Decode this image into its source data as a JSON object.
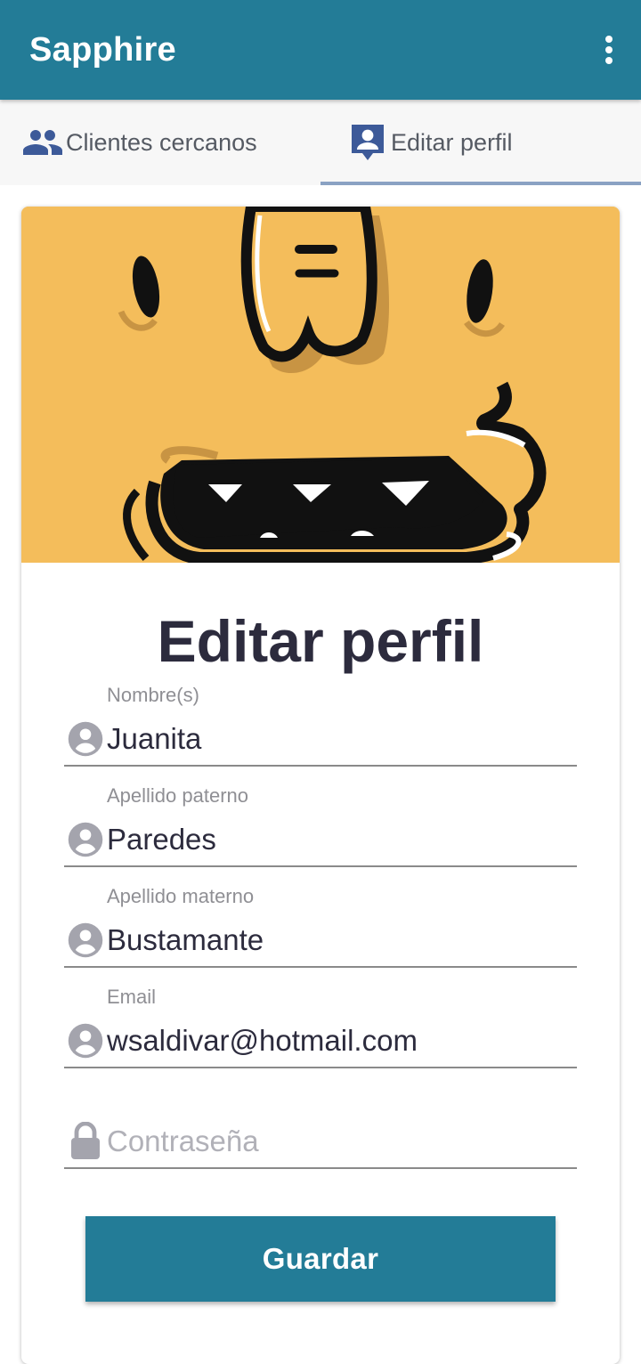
{
  "app": {
    "title": "Sapphire",
    "menu_icon": "more-vertical-icon",
    "brand_color": "#237c97"
  },
  "tabs": [
    {
      "label": "Clientes cercanos",
      "icon": "people-icon",
      "active": false
    },
    {
      "label": "Editar perfil",
      "icon": "account-box-icon",
      "active": true
    }
  ],
  "form": {
    "title": "Editar perfil",
    "fields": [
      {
        "label": "Nombre(s)",
        "value": "Juanita",
        "icon": "account-circle-icon"
      },
      {
        "label": "Apellido paterno",
        "value": "Paredes",
        "icon": "account-circle-icon"
      },
      {
        "label": "Apellido materno",
        "value": "Bustamante",
        "icon": "account-circle-icon"
      },
      {
        "label": "Email",
        "value": "wsaldivar@hotmail.com",
        "icon": "account-circle-icon"
      },
      {
        "label": "",
        "value": "",
        "placeholder": "Contraseña",
        "icon": "lock-icon"
      }
    ],
    "save_label": "Guardar"
  }
}
